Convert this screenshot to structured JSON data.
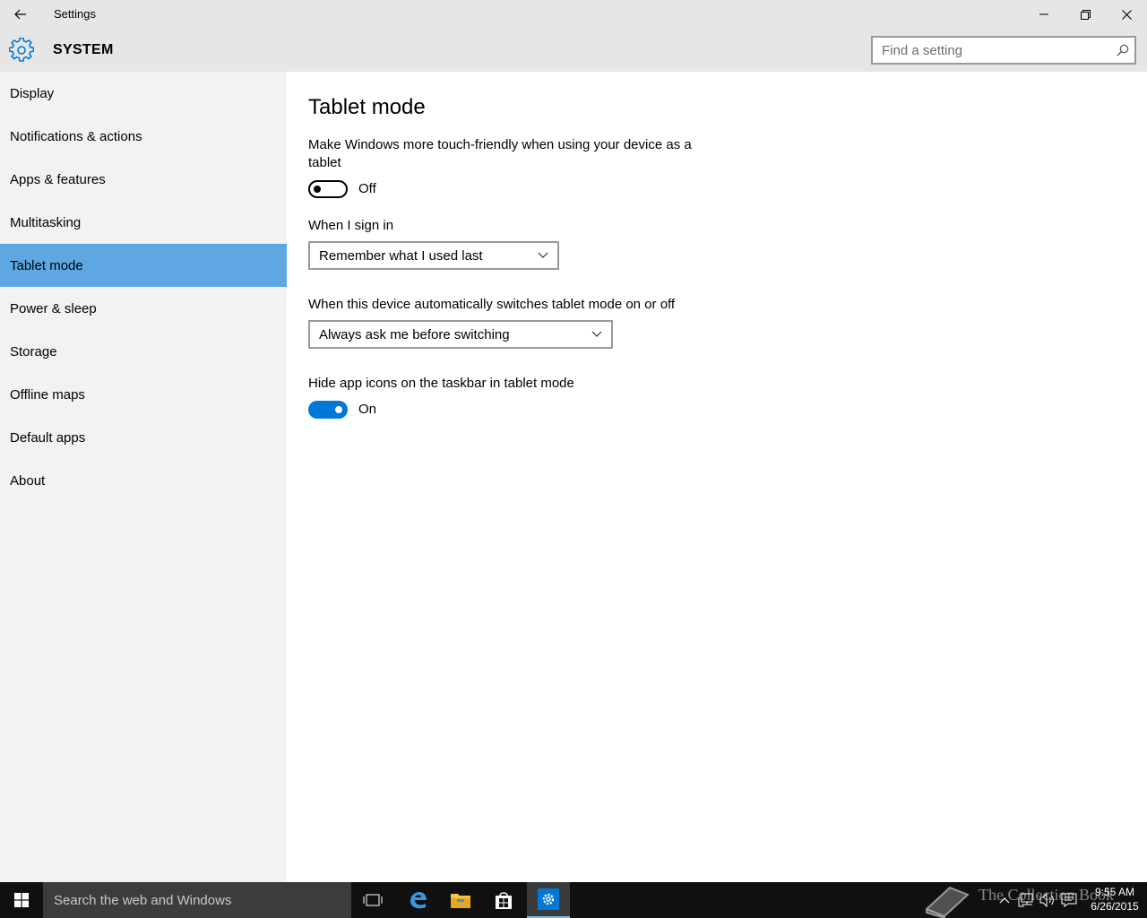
{
  "window": {
    "title": "Settings"
  },
  "header": {
    "section_title": "SYSTEM",
    "search_placeholder": "Find a setting"
  },
  "sidebar": {
    "items": [
      {
        "label": "Display"
      },
      {
        "label": "Notifications & actions"
      },
      {
        "label": "Apps & features"
      },
      {
        "label": "Multitasking"
      },
      {
        "label": "Tablet mode",
        "selected": true
      },
      {
        "label": "Power & sleep"
      },
      {
        "label": "Storage"
      },
      {
        "label": "Offline maps"
      },
      {
        "label": "Default apps"
      },
      {
        "label": "About"
      }
    ]
  },
  "main": {
    "title": "Tablet mode",
    "touch_friendly": {
      "description": "Make Windows more touch-friendly when using your device as a tablet",
      "state_label": "Off",
      "on": false
    },
    "sign_in": {
      "label": "When I sign in",
      "selected": "Remember what I used last"
    },
    "auto_switch": {
      "label": "When this device automatically switches tablet mode on or off",
      "selected": "Always ask me before switching"
    },
    "hide_icons": {
      "label": "Hide app icons on the taskbar in tablet mode",
      "state_label": "On",
      "on": true
    }
  },
  "taskbar": {
    "search_placeholder": "Search the web and Windows",
    "clock_time": "9:55 AM",
    "clock_date": "6/26/2015",
    "watermark": "The Collection Book"
  },
  "colors": {
    "accent": "#0078d7",
    "selected_nav": "#5ea7e3",
    "chrome": "#e6e6e6",
    "sidebar": "#f2f2f2"
  }
}
